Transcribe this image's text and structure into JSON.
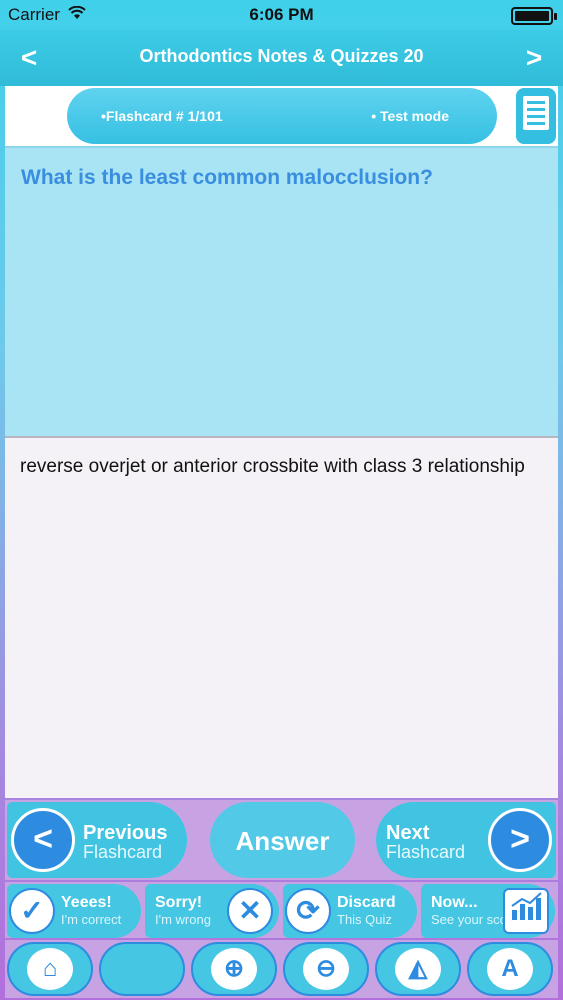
{
  "status_bar": {
    "carrier": "Carrier",
    "time": "6:06 PM"
  },
  "nav": {
    "title": "Orthodontics Notes & Quizzes 20",
    "back_icon": "chevron-left-icon",
    "forward_icon": "chevron-right-icon"
  },
  "info": {
    "flashcard_label": "•Flashcard #  1/101",
    "mode_label": "• Test mode"
  },
  "question": {
    "text": "What is the least common malocclusion?"
  },
  "answer": {
    "text": "reverse overjet or anterior crossbite with class 3 relationship"
  },
  "controls": {
    "previous": {
      "line1": "Previous",
      "line2": "Flashcard"
    },
    "answer": "Answer",
    "next": {
      "line1": "Next",
      "line2": "Flashcard"
    }
  },
  "actions": [
    {
      "line1": "Yeees!",
      "line2": "I'm correct",
      "icon": "check-icon"
    },
    {
      "line1": "Sorry!",
      "line2": "I'm wrong",
      "icon": "x-icon"
    },
    {
      "line1": "Discard",
      "line2": "This Quiz",
      "icon": "recycle-icon"
    },
    {
      "line1": "Now...",
      "line2": "See your score",
      "icon": "chart-icon"
    }
  ],
  "toolbar": [
    {
      "icon": "home-icon"
    },
    {
      "icon": "blank-icon"
    },
    {
      "icon": "zoom-in-icon"
    },
    {
      "icon": "zoom-out-icon"
    },
    {
      "icon": "paint-bucket-icon"
    },
    {
      "icon": "font-icon"
    }
  ],
  "colors": {
    "accent": "#41c4e2",
    "question_text": "#3a8ee0",
    "question_bg": "#a8e4f4",
    "answer_bg": "#f5f2f7"
  }
}
